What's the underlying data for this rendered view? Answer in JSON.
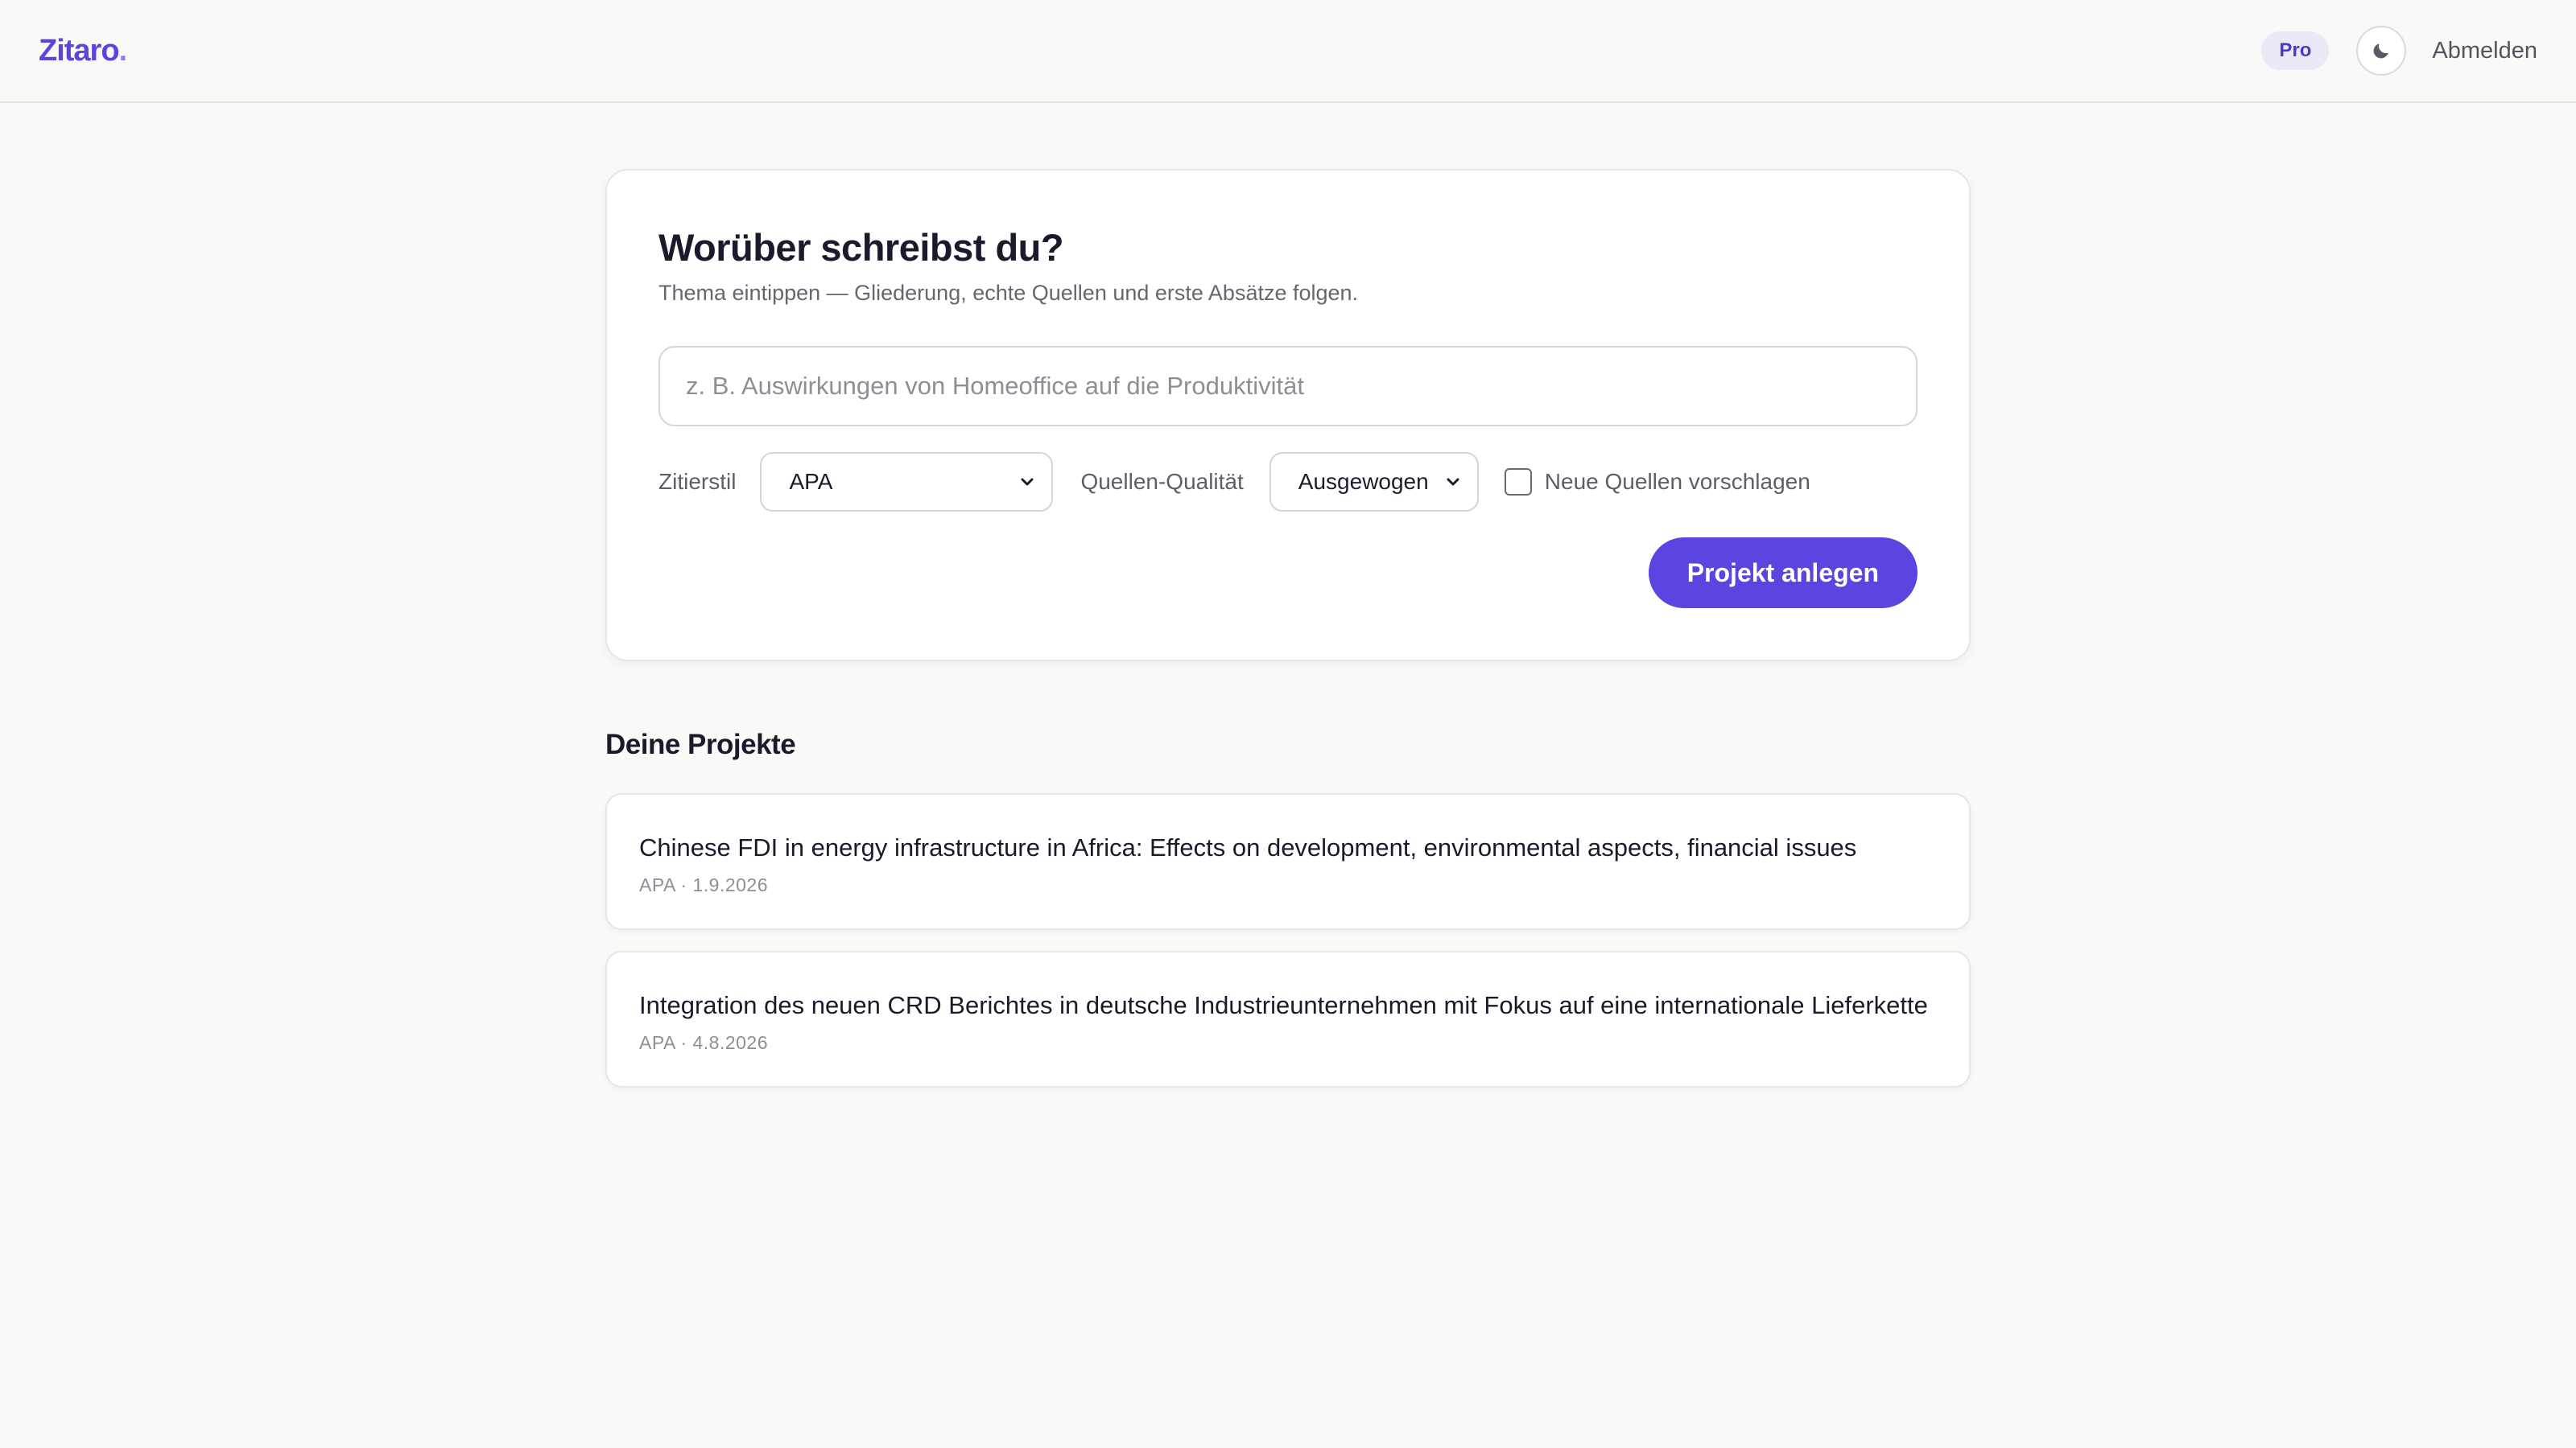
{
  "header": {
    "logo": "Zitaro",
    "logo_dot": ".",
    "badge": "Pro",
    "theme_icon": "moon-icon",
    "logout_label": "Abmelden"
  },
  "new_project": {
    "heading": "Worüber schreibst du?",
    "subtitle": "Thema eintippen — Gliederung, echte Quellen und erste Absätze folgen.",
    "topic_placeholder": "z. B. Auswirkungen von Homeoffice auf die Produktivität",
    "topic_value": "",
    "citation_label": "Zitierstil",
    "citation_value": "APA",
    "quality_label": "Quellen-Qualität",
    "quality_value": "Ausgewogen",
    "suggest_label": "Neue Quellen vorschlagen",
    "suggest_checked": false,
    "submit_label": "Projekt anlegen"
  },
  "projects": {
    "title": "Deine Projekte",
    "items": [
      {
        "title": "Chinese FDI in energy infrastructure in Africa: Effects on development, environmental aspects, financial issues",
        "meta": "APA · 1.9.2026"
      },
      {
        "title": "Integration des neuen CRD Berichtes in deutsche Industrieunternehmen mit Fokus auf eine internationale Lieferkette",
        "meta": "APA · 4.8.2026"
      }
    ]
  },
  "colors": {
    "accent": "#5b45e0",
    "background": "#faf9f7",
    "badge_bg": "#ebe8f7"
  }
}
